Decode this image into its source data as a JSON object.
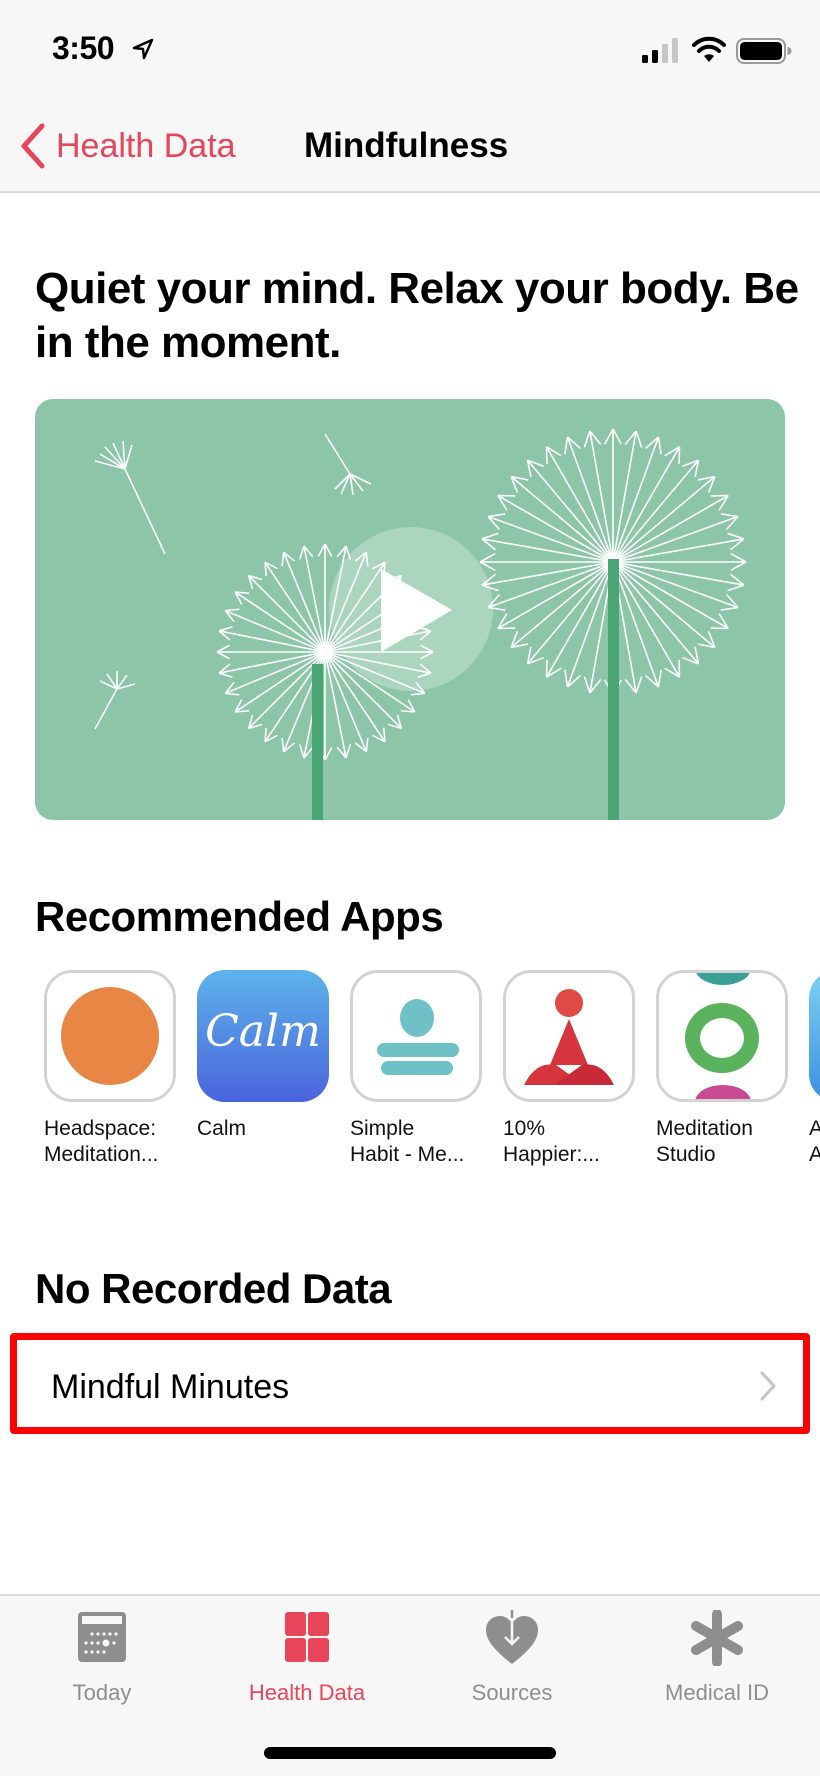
{
  "status_bar": {
    "time": "3:50",
    "icons": [
      "location-arrow-icon",
      "cellular-signal-icon",
      "wifi-icon",
      "battery-icon"
    ]
  },
  "nav": {
    "back_label": "Health Data",
    "title": "Mindfulness"
  },
  "headline": "Quiet your mind. Relax your body. Be in the moment.",
  "video": {
    "icon": "play-icon",
    "background": "#8cc5a8"
  },
  "recommended": {
    "title": "Recommended Apps",
    "apps": [
      {
        "name": "Headspace:\nMeditation..."
      },
      {
        "name": "Calm",
        "logo_text": "Calm"
      },
      {
        "name": "Simple\nHabit - Me..."
      },
      {
        "name": "10%\nHappier:..."
      },
      {
        "name": "Meditation\nStudio"
      },
      {
        "name": "A\nA"
      }
    ]
  },
  "no_data": {
    "title": "No Recorded Data",
    "rows": [
      {
        "label": "Mindful Minutes"
      }
    ]
  },
  "tabs": [
    {
      "label": "Today",
      "icon": "calendar-icon",
      "active": false
    },
    {
      "label": "Health Data",
      "icon": "grid-icon",
      "active": true
    },
    {
      "label": "Sources",
      "icon": "heart-download-icon",
      "active": false
    },
    {
      "label": "Medical ID",
      "icon": "asterisk-icon",
      "active": false
    }
  ],
  "colors": {
    "accent": "#e8445a",
    "highlight_border": "#ff0000",
    "tab_inactive": "#8e8e8e"
  }
}
